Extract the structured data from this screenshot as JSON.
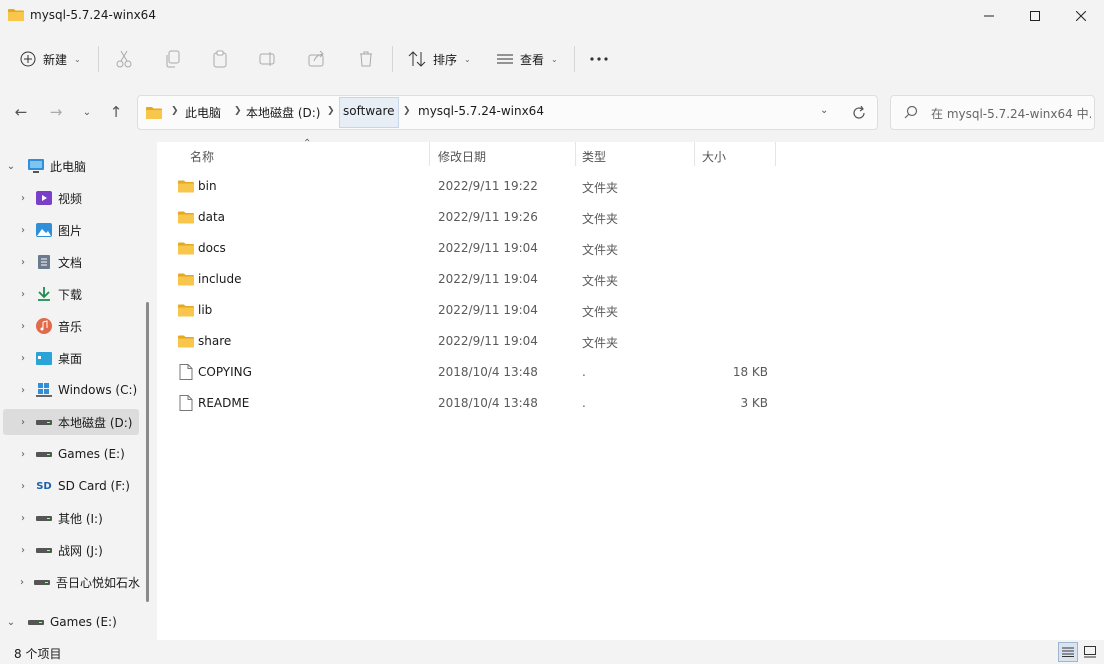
{
  "window": {
    "title": "mysql-5.7.24-winx64",
    "minimize_label": "Minimize",
    "maximize_label": "Maximize",
    "close_label": "Close"
  },
  "toolbar": {
    "new_label": "新建",
    "sort_label": "排序",
    "view_label": "查看",
    "icons": [
      "cut-icon",
      "copy-icon",
      "paste-icon",
      "rename-icon",
      "share-icon",
      "delete-icon",
      "more-icon"
    ]
  },
  "address": {
    "crumbs": [
      "此电脑",
      "本地磁盘 (D:)",
      "software",
      "mysql-5.7.24-winx64"
    ],
    "search_placeholder": "在 mysql-5.7.24-winx64 中..."
  },
  "sidebar": {
    "items": [
      {
        "label": "此电脑",
        "icon": "pc-icon",
        "expanded": true
      },
      {
        "label": "视频",
        "icon": "video-icon"
      },
      {
        "label": "图片",
        "icon": "pictures-icon"
      },
      {
        "label": "文档",
        "icon": "documents-icon"
      },
      {
        "label": "下载",
        "icon": "download-icon"
      },
      {
        "label": "音乐",
        "icon": "music-icon"
      },
      {
        "label": "桌面",
        "icon": "desktop-icon"
      },
      {
        "label": "Windows (C:)",
        "icon": "windows-drive-icon"
      },
      {
        "label": "本地磁盘 (D:)",
        "icon": "drive-icon",
        "selected": true
      },
      {
        "label": "Games (E:)",
        "icon": "drive-icon"
      },
      {
        "label": "SD Card (F:)",
        "icon": "sd-card-icon"
      },
      {
        "label": "其他 (I:)",
        "icon": "drive-icon"
      },
      {
        "label": "战网 (J:)",
        "icon": "drive-icon"
      },
      {
        "label": "吾日心悦如石水",
        "icon": "drive-icon"
      },
      {
        "label": "Games (E:)",
        "icon": "drive-icon",
        "expanded": true
      }
    ]
  },
  "columns": {
    "name": "名称",
    "date": "修改日期",
    "type": "类型",
    "size": "大小"
  },
  "files": [
    {
      "name": "bin",
      "date": "2022/9/11 19:22",
      "type": "文件夹",
      "size": "",
      "kind": "folder"
    },
    {
      "name": "data",
      "date": "2022/9/11 19:26",
      "type": "文件夹",
      "size": "",
      "kind": "folder"
    },
    {
      "name": "docs",
      "date": "2022/9/11 19:04",
      "type": "文件夹",
      "size": "",
      "kind": "folder"
    },
    {
      "name": "include",
      "date": "2022/9/11 19:04",
      "type": "文件夹",
      "size": "",
      "kind": "folder"
    },
    {
      "name": "lib",
      "date": "2022/9/11 19:04",
      "type": "文件夹",
      "size": "",
      "kind": "folder"
    },
    {
      "name": "share",
      "date": "2022/9/11 19:04",
      "type": "文件夹",
      "size": "",
      "kind": "folder"
    },
    {
      "name": "COPYING",
      "date": "2018/10/4 13:48",
      "type": ".",
      "size": "18 KB",
      "kind": "file"
    },
    {
      "name": "README",
      "date": "2018/10/4 13:48",
      "type": ".",
      "size": "3 KB",
      "kind": "file"
    }
  ],
  "status": {
    "count": "8 个项目"
  },
  "colors": {
    "folder": "#f7c64a",
    "folder_dark": "#e5a823",
    "selected_bg": "#dcdcdc",
    "accent": "#0067c0"
  }
}
